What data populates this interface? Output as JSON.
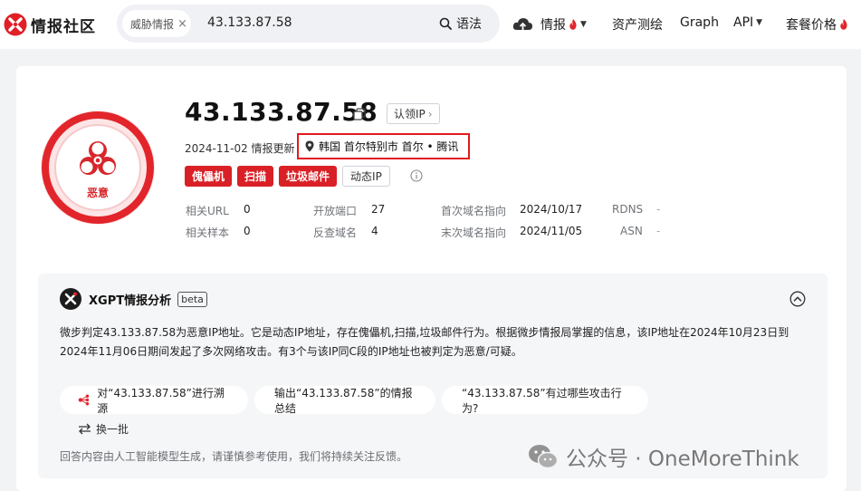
{
  "brand": {
    "name": "情报社区"
  },
  "search": {
    "chip": "威胁情报",
    "chip_close": "×",
    "query": "43.133.87.58",
    "syntax_label": "语法"
  },
  "nav": {
    "intel": "情报",
    "assets": "资产测绘",
    "graph": "Graph",
    "api": "API",
    "pricing": "套餐价格"
  },
  "verdict": {
    "label": "恶意",
    "color": "#e2252b"
  },
  "ip": {
    "address": "43.133.87.58",
    "claim_label": "认领IP",
    "claim_arrow": "›",
    "updated": "2024-11-02 情报更新",
    "location": "韩国 首尔特别市 首尔 • 腾讯"
  },
  "tags": [
    "傀儡机",
    "扫描",
    "垃圾邮件"
  ],
  "dynamic_tag": "动态IP",
  "stats": [
    {
      "label": "相关URL",
      "value": "0"
    },
    {
      "label": "相关样本",
      "value": "0"
    },
    {
      "label": "开放端口",
      "value": "27"
    },
    {
      "label": "反查域名",
      "value": "4"
    },
    {
      "label": "首次域名指向",
      "value": "2024/10/17"
    },
    {
      "label": "末次域名指向",
      "value": "2024/11/05"
    },
    {
      "label": "RDNS",
      "value": "-"
    },
    {
      "label": "ASN",
      "value": "-"
    }
  ],
  "xgpt": {
    "title": "XGPT情报分析",
    "beta": "beta",
    "analysis": "微步判定43.133.87.58为恶意IP地址。它是动态IP地址，存在傀儡机,扫描,垃圾邮件行为。根据微步情报局掌握的信息，该IP地址在2024年10月23日到2024年11月06日期间发起了多次网络攻击。有3个与该IP同C段的IP地址也被判定为恶意/可疑。",
    "suggestions": [
      "对“43.133.87.58”进行溯源",
      "输出“43.133.87.58”的情报总结",
      "“43.133.87.58”有过哪些攻击行为?"
    ],
    "refresh": "换一批",
    "disclaimer": "回答内容由人工智能模型生成，请谨慎参考使用，我们将持续关注反馈。"
  },
  "watermark": "公众号 · OneMoreThink",
  "colors": {
    "accent_red": "#d92026",
    "highlight_box": "#e3191c"
  }
}
